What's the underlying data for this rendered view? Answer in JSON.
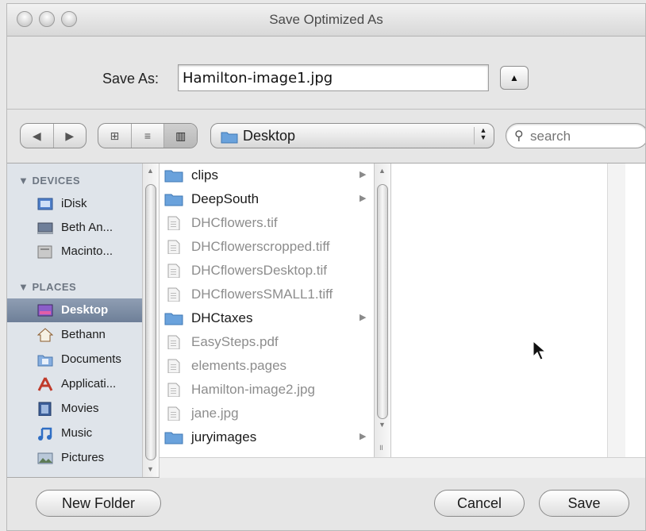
{
  "window": {
    "title": "Save Optimized As",
    "traffic_lights": [
      "close",
      "minimize",
      "zoom"
    ]
  },
  "save_as": {
    "label": "Save As:",
    "filename": "Hamilton-image1.jpg",
    "expand_icon": "triangle-up-icon"
  },
  "toolbar": {
    "nav": [
      "◀",
      "▶"
    ],
    "view_modes": [
      {
        "icon": "icon-view-icon",
        "glyph": "⊞"
      },
      {
        "icon": "list-view-icon",
        "glyph": "≡"
      },
      {
        "icon": "column-view-icon",
        "glyph": "▥"
      }
    ],
    "location": "Desktop",
    "search_placeholder": "search"
  },
  "sidebar": {
    "devices_header": "▼ DEVICES",
    "places_header": "▼ PLACES",
    "devices": [
      {
        "label": "iDisk",
        "icon": "idisk-icon"
      },
      {
        "label": "Beth An...",
        "icon": "computer-icon"
      },
      {
        "label": "Macinto...",
        "icon": "hard-drive-icon"
      }
    ],
    "places": [
      {
        "label": "Desktop",
        "icon": "desktop-icon",
        "selected": true
      },
      {
        "label": "Bethann",
        "icon": "home-icon"
      },
      {
        "label": "Documents",
        "icon": "documents-folder-icon"
      },
      {
        "label": "Applicati...",
        "icon": "applications-icon"
      },
      {
        "label": "Movies",
        "icon": "movies-icon"
      },
      {
        "label": "Music",
        "icon": "music-icon"
      },
      {
        "label": "Pictures",
        "icon": "pictures-icon"
      }
    ]
  },
  "files": [
    {
      "name": "clips",
      "kind": "folder",
      "enabled": true
    },
    {
      "name": "DeepSouth",
      "kind": "folder",
      "enabled": true
    },
    {
      "name": "DHCflowers.tif",
      "kind": "file",
      "enabled": false
    },
    {
      "name": "DHCflowerscropped.tiff",
      "kind": "file",
      "enabled": false
    },
    {
      "name": "DHCflowersDesktop.tif",
      "kind": "file",
      "enabled": false
    },
    {
      "name": "DHCflowersSMALL1.tiff",
      "kind": "file",
      "enabled": false
    },
    {
      "name": "DHCtaxes",
      "kind": "folder",
      "enabled": true
    },
    {
      "name": "EasySteps.pdf",
      "kind": "file",
      "enabled": false
    },
    {
      "name": "elements.pages",
      "kind": "file",
      "enabled": false
    },
    {
      "name": "Hamilton-image2.jpg",
      "kind": "file",
      "enabled": false
    },
    {
      "name": "jane.jpg",
      "kind": "file",
      "enabled": false
    },
    {
      "name": "juryimages",
      "kind": "folder",
      "enabled": true
    }
  ],
  "buttons": {
    "new_folder": "New Folder",
    "cancel": "Cancel",
    "save": "Save"
  },
  "colors": {
    "selection": "#7d8ea7",
    "sidebar_bg": "#dfe4ea",
    "folder_blue": "#6aa2dc"
  }
}
